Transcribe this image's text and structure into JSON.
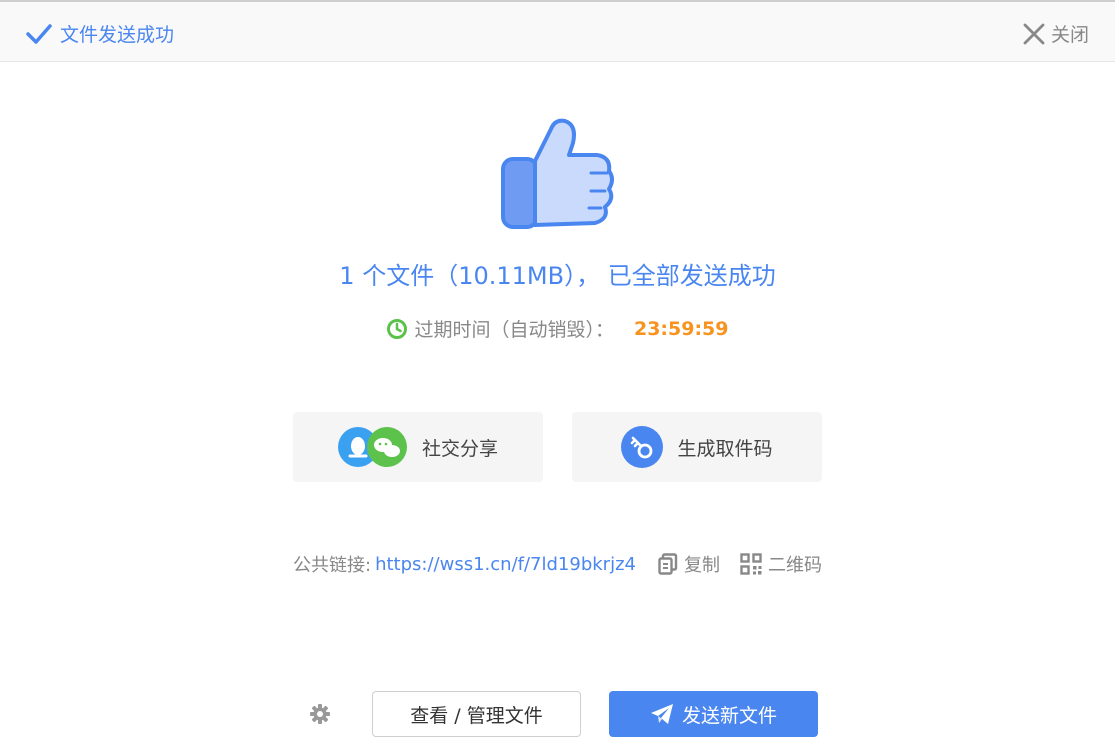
{
  "header": {
    "title": "文件发送成功",
    "close_label": "关闭"
  },
  "result": {
    "headline": "1 个文件（10.11MB），  已全部发送成功",
    "expire_label": "过期时间（自动销毁）：",
    "expire_time": "23:59:59"
  },
  "actions": {
    "social_share": "社交分享",
    "pickup_code": "生成取件码"
  },
  "public_link": {
    "label": "公共链接:",
    "url": "https://wss1.cn/f/7ld19bkrjz4",
    "copy_label": "复制",
    "qrcode_label": "二维码"
  },
  "footer": {
    "manage_label": "查看 / 管理文件",
    "send_new_label": "发送新文件"
  },
  "colors": {
    "accent": "#4a86f0",
    "timer": "#f7931e",
    "clock": "#5cc24c"
  }
}
